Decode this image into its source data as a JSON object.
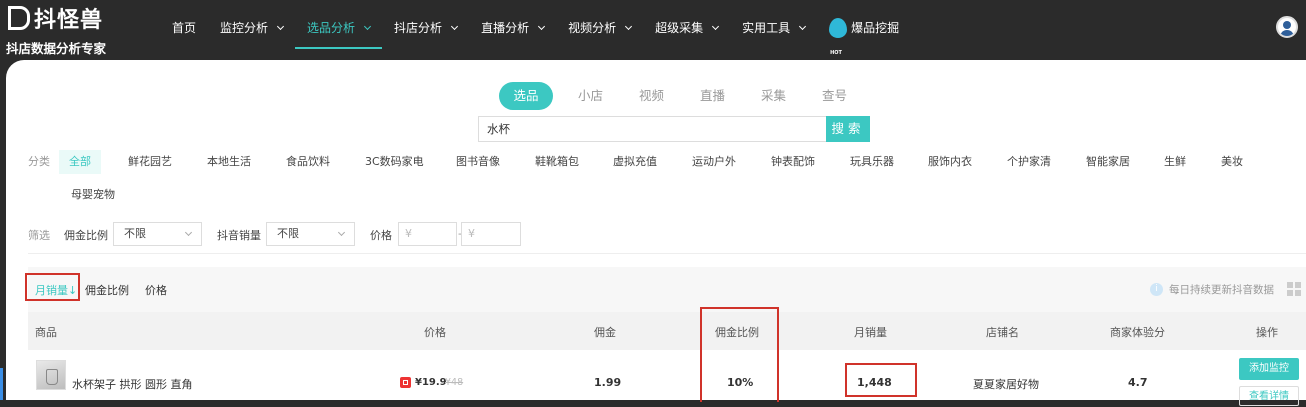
{
  "logo": {
    "brand": "抖怪兽",
    "tagline": "抖店数据分析专家"
  },
  "nav": [
    {
      "label": "首页",
      "dropdown": false,
      "active": false
    },
    {
      "label": "监控分析",
      "dropdown": true,
      "active": false
    },
    {
      "label": "选品分析",
      "dropdown": true,
      "active": true
    },
    {
      "label": "抖店分析",
      "dropdown": true,
      "active": false
    },
    {
      "label": "直播分析",
      "dropdown": true,
      "active": false
    },
    {
      "label": "视频分析",
      "dropdown": true,
      "active": false
    },
    {
      "label": "超级采集",
      "dropdown": true,
      "active": false
    },
    {
      "label": "实用工具",
      "dropdown": true,
      "active": false
    },
    {
      "label": "爆品挖掘",
      "dropdown": false,
      "active": false,
      "icon": "hot-flame-icon"
    }
  ],
  "tabs": [
    "选品",
    "小店",
    "视频",
    "直播",
    "采集",
    "查号"
  ],
  "active_tab": "选品",
  "search": {
    "value": "水杯",
    "button": "搜索"
  },
  "category": {
    "label": "分类",
    "items": [
      "全部",
      "鲜花园艺",
      "本地生活",
      "食品饮料",
      "3C数码家电",
      "图书音像",
      "鞋靴箱包",
      "虚拟充值",
      "运动户外",
      "钟表配饰",
      "玩具乐器",
      "服饰内衣",
      "个护家清",
      "智能家居",
      "生鲜",
      "美妆",
      "母婴宠物"
    ],
    "active": "全部"
  },
  "filter": {
    "label": "筛选",
    "commission_label": "佣金比例",
    "commission_value": "不限",
    "sales_label": "抖音销量",
    "sales_value": "不限",
    "price_label": "价格",
    "price_min_placeholder": "¥",
    "price_max_placeholder": "¥",
    "dash": "-"
  },
  "sort": {
    "items": [
      "月销量↓",
      "佣金比例",
      "价格"
    ],
    "active": "月销量↓",
    "note": "每日持续更新抖音数据"
  },
  "table": {
    "headers": [
      "商品",
      "价格",
      "佣金",
      "佣金比例",
      "月销量",
      "店铺名",
      "商家体验分",
      "操作"
    ],
    "rows": [
      {
        "title": "水杯架子 拱形 圆形 直角",
        "price": "¥19.9",
        "price_old": "¥48",
        "commission": "1.99",
        "commission_rate": "10%",
        "monthly_sales": "1,448",
        "shop": "夏夏家居好物",
        "score": "4.7",
        "action_primary": "添加监控",
        "action_secondary": "查看详情"
      }
    ]
  },
  "colors": {
    "accent": "#3cc8c2",
    "topbar": "#2b2b2b",
    "highlight": "#d0332a"
  }
}
